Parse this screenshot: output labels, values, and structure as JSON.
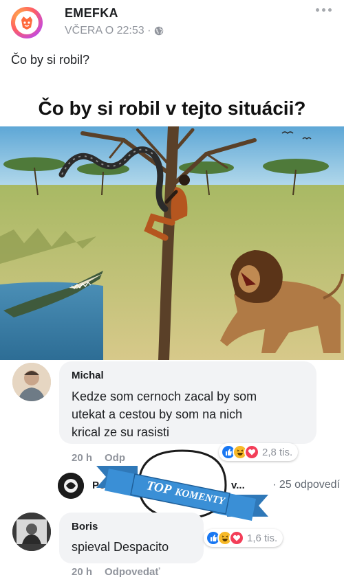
{
  "post": {
    "page_name": "EMEFKA",
    "timestamp": "VČERA O 22:53 ·",
    "text": "Čo by si robil?"
  },
  "image": {
    "title": "Čo by si robil v tejto situácii?"
  },
  "comments": [
    {
      "author": "Michal",
      "lines": [
        "Kedze som cernoch zacal by som",
        "utekat a cestou by som na nich",
        "krical ze su rasisti"
      ],
      "time": "20 h",
      "action": "Odp",
      "reaction_count": "2,8 tis."
    },
    {
      "author": "Boris",
      "lines": [
        "spieval Despacito"
      ],
      "time": "20 h",
      "action": "Odpovedať",
      "reaction_count": "1,6 tis."
    }
  ],
  "reply_row": {
    "label": "Použ",
    "ellipsis": "v...",
    "count": "· 25 odpovedí"
  },
  "badge": {
    "word1": "TOP",
    "word2": "KOMENTY"
  },
  "colors": {
    "like": "#1877f2",
    "love": "#f33e58",
    "haha": "#f7b928",
    "ribbon": "#3a8fd6"
  },
  "icons": [
    "page-logo-icon",
    "globe-icon",
    "more-options-icon",
    "like-reaction-icon",
    "haha-reaction-icon",
    "love-reaction-icon"
  ]
}
